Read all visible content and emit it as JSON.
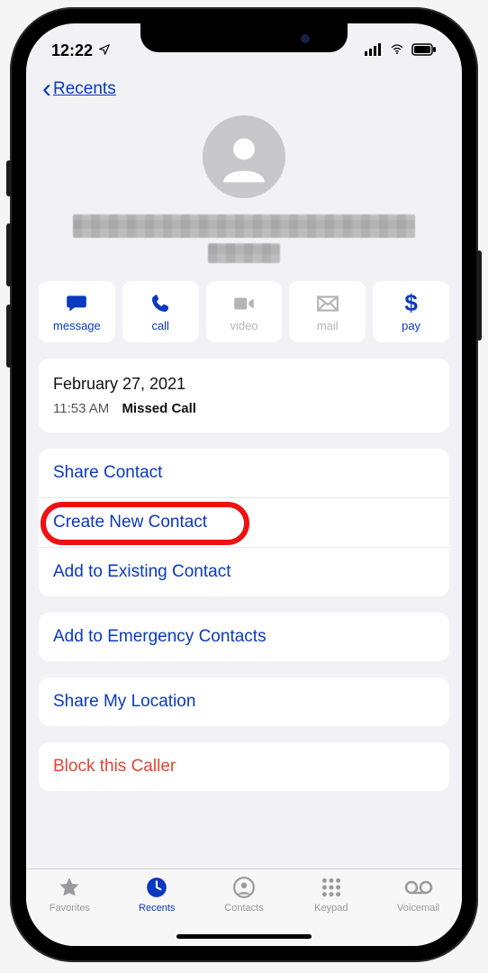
{
  "status": {
    "time": "12:22"
  },
  "nav": {
    "back_label": "Recents"
  },
  "actions": {
    "message": "message",
    "call": "call",
    "video": "video",
    "mail": "mail",
    "pay": "pay"
  },
  "history": {
    "date": "February 27, 2021",
    "time": "11:53 AM",
    "type": "Missed Call"
  },
  "items": {
    "share_contact": "Share Contact",
    "create_new": "Create New Contact",
    "add_existing": "Add to Existing Contact",
    "add_emergency": "Add to Emergency Contacts",
    "share_location": "Share My Location",
    "block": "Block this Caller"
  },
  "tabs": {
    "favorites": "Favorites",
    "recents": "Recents",
    "contacts": "Contacts",
    "keypad": "Keypad",
    "voicemail": "Voicemail"
  }
}
